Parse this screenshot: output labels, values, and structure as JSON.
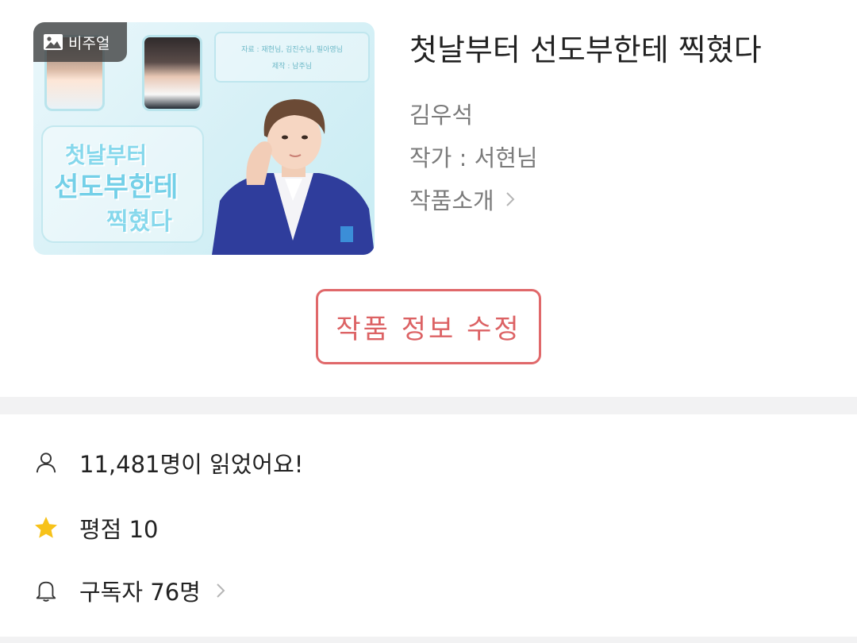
{
  "cover": {
    "badge_label": "비주얼",
    "art_title_line1": "첫날부터",
    "art_title_line2": "선도부한테",
    "art_title_line3": "찍혔다",
    "credit_line1": "자료 : 재현님, 김진수님, 필아영님",
    "credit_line2": "제작 : 남주님"
  },
  "work": {
    "title": "첫날부터 선도부한테 찍혔다",
    "subject": "김우석",
    "author": "작가 : 서현님",
    "intro_link": "작품소개"
  },
  "edit_button_label": "작품 정보 수정",
  "stats": {
    "readers": "11,481명이 읽었어요!",
    "rating": "평점 10",
    "subscribers": "구독자 76명"
  },
  "colors": {
    "accent": "#e0686a",
    "star": "#f7c21a",
    "muted_text": "#7b7b7b",
    "divider": "#f2f2f3"
  },
  "icons": {
    "badge": "image-icon",
    "intro": "chevron-right-icon",
    "readers": "user-icon",
    "rating": "star-icon",
    "subscribers": "bell-icon"
  }
}
